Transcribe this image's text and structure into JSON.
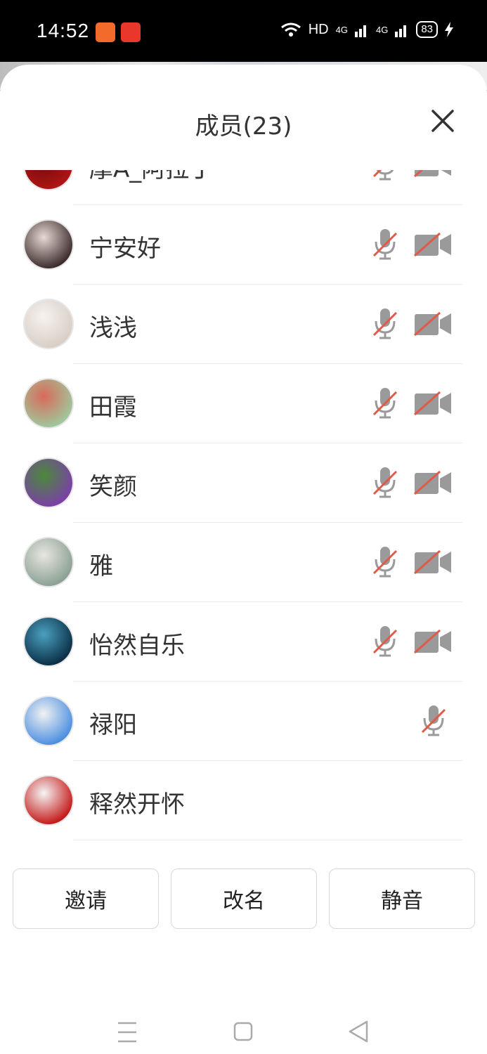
{
  "status_bar": {
    "time": "14:52",
    "hd": "HD",
    "net1": "4G",
    "net2": "4G",
    "battery": "83"
  },
  "header": {
    "title": "成员(23)"
  },
  "members": [
    {
      "name": "摩A_阿拉丁",
      "mic_muted": true,
      "camera_off": true,
      "avatar_colors": [
        "#b01515",
        "#6a0a0a"
      ]
    },
    {
      "name": "宁安好",
      "mic_muted": true,
      "camera_off": true,
      "avatar_colors": [
        "#3a2a2a",
        "#e8d8d2"
      ]
    },
    {
      "name": "浅浅",
      "mic_muted": true,
      "camera_off": true,
      "avatar_colors": [
        "#d8cec6",
        "#f6f2ee"
      ]
    },
    {
      "name": "田霞",
      "mic_muted": true,
      "camera_off": true,
      "avatar_colors": [
        "#9fc89c",
        "#d86a5a"
      ]
    },
    {
      "name": "笑颜",
      "mic_muted": true,
      "camera_off": true,
      "avatar_colors": [
        "#7b3fa8",
        "#4b8a3a"
      ]
    },
    {
      "name": "雅",
      "mic_muted": true,
      "camera_off": true,
      "avatar_colors": [
        "#8aa094",
        "#e8e6e0"
      ]
    },
    {
      "name": "怡然自乐",
      "mic_muted": true,
      "camera_off": true,
      "avatar_colors": [
        "#0b2e45",
        "#4aa0c0"
      ]
    },
    {
      "name": "禄阳",
      "mic_muted": true,
      "camera_off": false,
      "avatar_colors": [
        "#4a8ee0",
        "#f2f2f2"
      ]
    },
    {
      "name": "释然开怀",
      "mic_muted": false,
      "camera_off": false,
      "avatar_colors": [
        "#c41818",
        "#f5f5f5"
      ]
    }
  ],
  "actions": {
    "invite": "邀请",
    "rename": "改名",
    "mute": "静音"
  },
  "colors": {
    "muted_slash": "#e05a4a",
    "icon_gray": "#9a9a9a"
  }
}
